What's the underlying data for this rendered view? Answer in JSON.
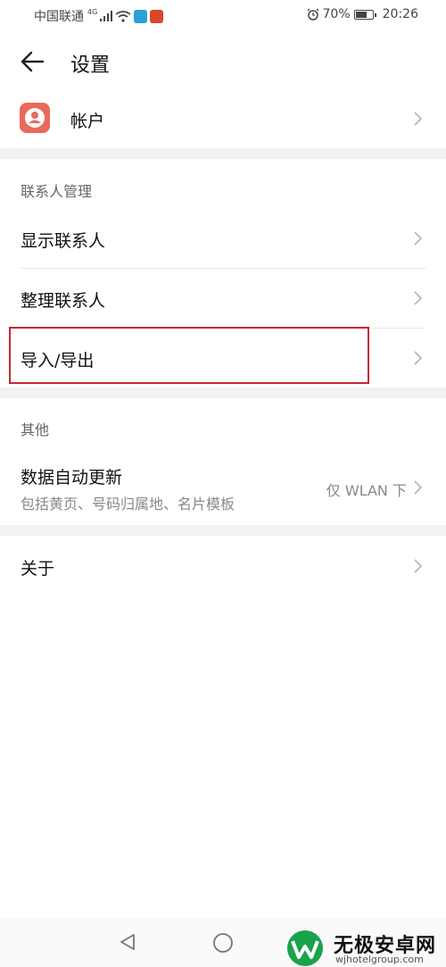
{
  "status_bar": {
    "carrier": "中国联通",
    "network": "4G",
    "battery_percent": "70%",
    "battery_level": 0.7,
    "time": "20:26",
    "icons": [
      "signal-icon",
      "wifi-icon",
      "app-notification-icon",
      "app-notification-icon",
      "alarm-icon",
      "battery-icon"
    ]
  },
  "header": {
    "title": "设置",
    "back_icon": "arrow-left-icon"
  },
  "account": {
    "label": "帐户",
    "icon": "person-icon"
  },
  "contacts_section": {
    "header": "联系人管理",
    "items": [
      {
        "label": "显示联系人"
      },
      {
        "label": "整理联系人"
      },
      {
        "label": "导入/导出"
      }
    ]
  },
  "other_section": {
    "header": "其他",
    "data_update": {
      "label": "数据自动更新",
      "sub_label": "包括黄页、号码归属地、名片模板",
      "value": "仅 WLAN 下"
    }
  },
  "about": {
    "label": "关于"
  },
  "nav_bar": {
    "icons": [
      "back-triangle-icon",
      "home-circle-icon"
    ]
  },
  "watermark": {
    "title": "无极安卓网",
    "url": "wjhotelgroup.com"
  },
  "colors": {
    "highlight": "#c22a31",
    "account_icon_bg": "#e86a5c",
    "section_gap": "#f2f2f2",
    "watermark_green": "#1aa34a"
  }
}
